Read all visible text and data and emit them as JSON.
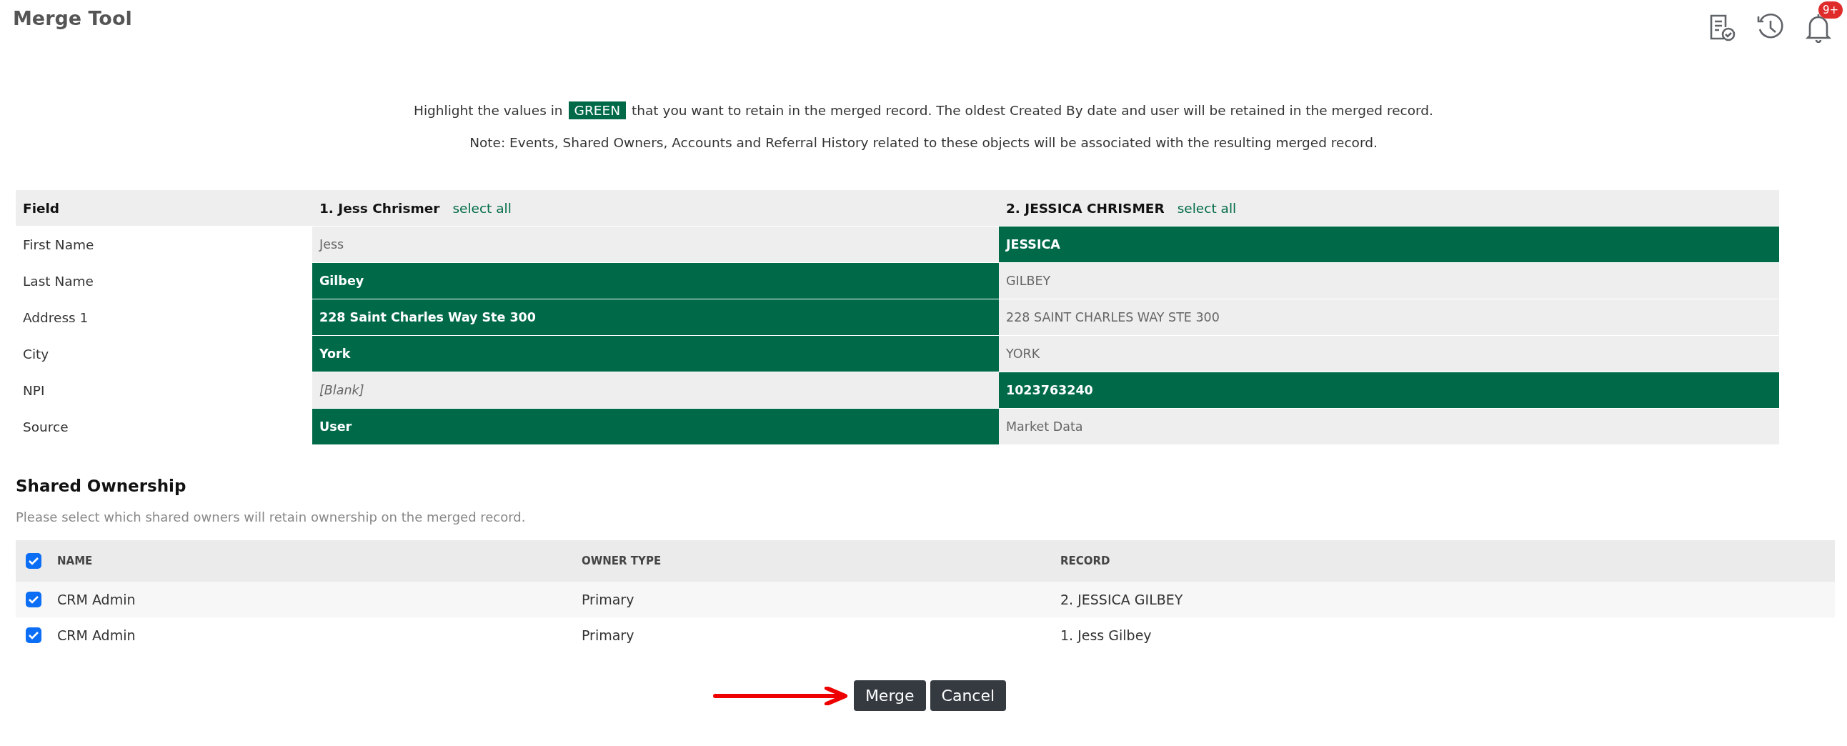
{
  "header": {
    "title": "Merge Tool",
    "notification_badge": "9+"
  },
  "instructions": {
    "before": "Highlight the values in",
    "highlight": "GREEN",
    "after": "that you want to retain in the merged record. The oldest Created By date and user will be retained in the merged record.",
    "note": "Note: Events, Shared Owners, Accounts and Referral History related to these objects will be associated with the resulting merged record."
  },
  "merge_table": {
    "field_heading": "Field",
    "records": [
      {
        "name": "1. Jess Chrismer",
        "select_all": "select all"
      },
      {
        "name": "2. JESSICA CHRISMER",
        "select_all": "select all"
      }
    ],
    "rows": [
      {
        "field": "First Name",
        "values": [
          {
            "text": "Jess",
            "kind": "value",
            "selected": false
          },
          {
            "text": "JESSICA",
            "kind": "value",
            "selected": true
          }
        ]
      },
      {
        "field": "Last Name",
        "values": [
          {
            "text": "Gilbey",
            "kind": "value",
            "selected": true
          },
          {
            "text": "GILBEY",
            "kind": "value",
            "selected": false
          }
        ]
      },
      {
        "field": "Address 1",
        "values": [
          {
            "text": "228 Saint Charles Way Ste 300",
            "kind": "value",
            "selected": true
          },
          {
            "text": "228 SAINT CHARLES WAY STE 300",
            "kind": "value",
            "selected": false
          }
        ]
      },
      {
        "field": "City",
        "values": [
          {
            "text": "York",
            "kind": "value",
            "selected": true
          },
          {
            "text": "YORK",
            "kind": "value",
            "selected": false
          }
        ]
      },
      {
        "field": "NPI",
        "values": [
          {
            "text": "[Blank]",
            "kind": "blank",
            "selected": false
          },
          {
            "text": "1023763240",
            "kind": "value",
            "selected": true
          }
        ]
      },
      {
        "field": "Source",
        "values": [
          {
            "text": "User",
            "kind": "value",
            "selected": true
          },
          {
            "text": "Market Data",
            "kind": "value",
            "selected": false
          }
        ]
      }
    ]
  },
  "shared_ownership": {
    "title": "Shared Ownership",
    "description": "Please select which shared owners will retain ownership on the merged record.",
    "all_checked": true,
    "columns": [
      "NAME",
      "OWNER TYPE",
      "RECORD"
    ],
    "rows": [
      {
        "checked": true,
        "name": "CRM Admin",
        "owner_type": "Primary",
        "record": "2. JESSICA GILBEY"
      },
      {
        "checked": true,
        "name": "CRM Admin",
        "owner_type": "Primary",
        "record": "1. Jess Gilbey"
      }
    ]
  },
  "buttons": [
    "Merge",
    "Cancel"
  ]
}
